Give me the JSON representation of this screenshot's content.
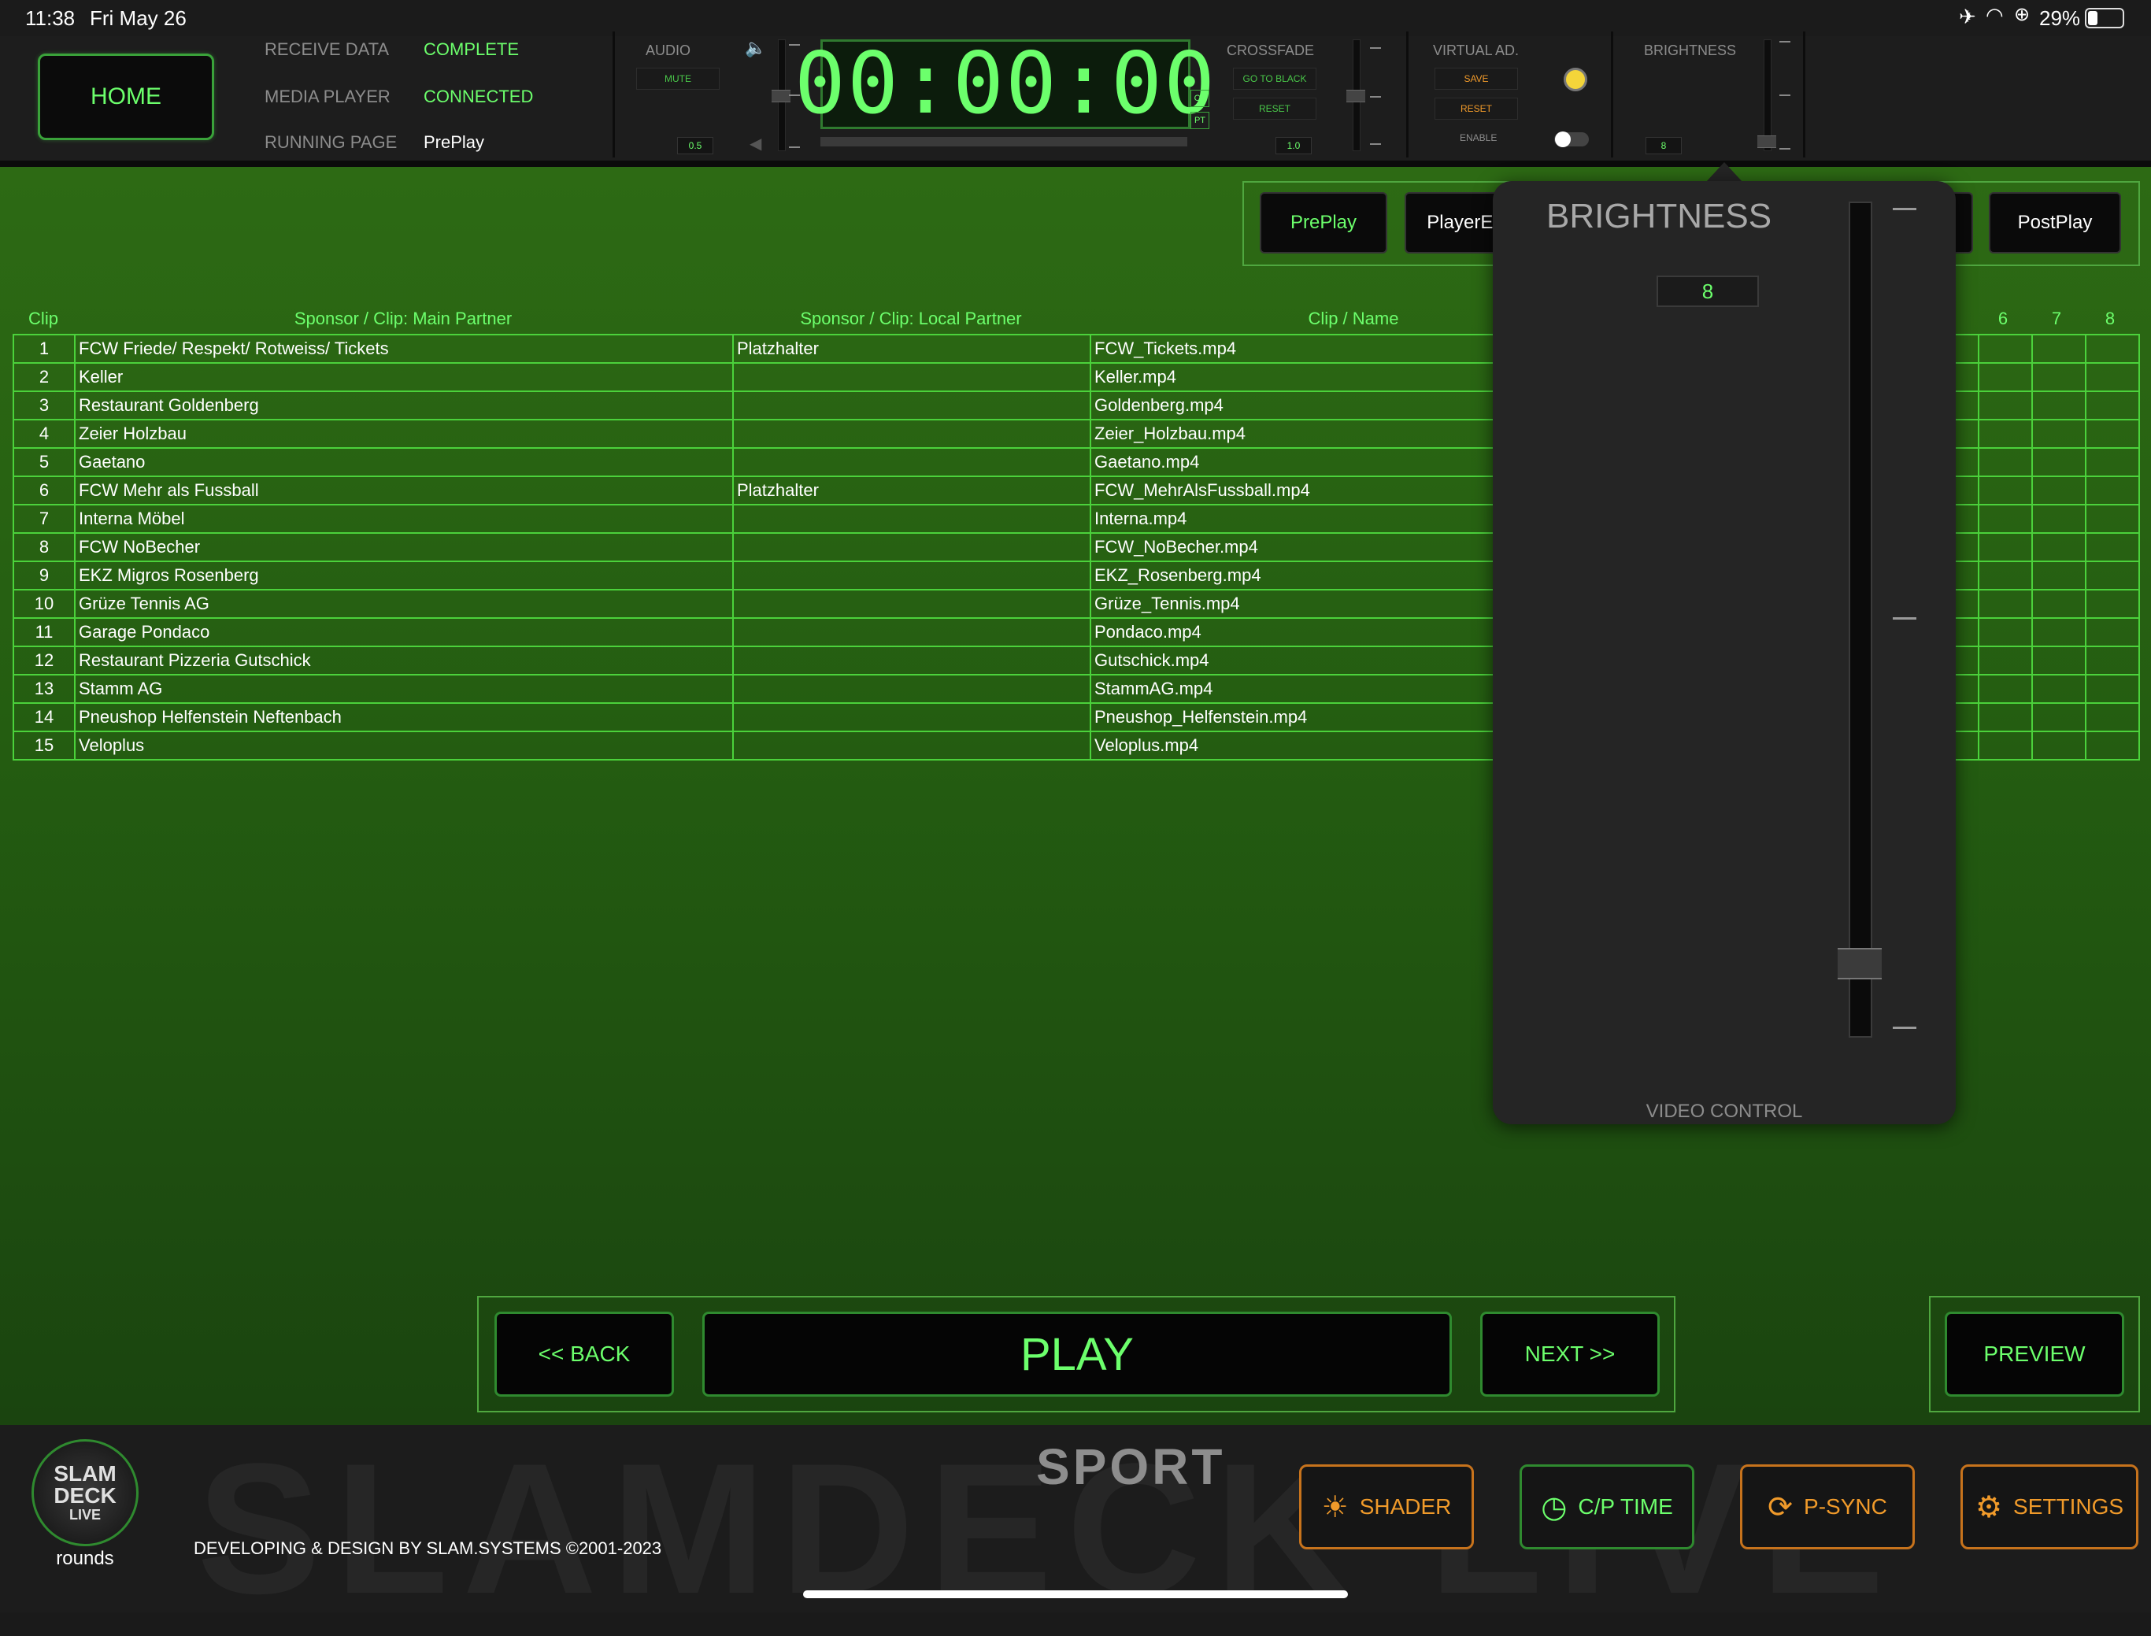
{
  "status_bar": {
    "time": "11:38",
    "date": "Fri May 26",
    "battery": "29%"
  },
  "header": {
    "home_label": "HOME",
    "info": [
      {
        "label": "RECEIVE DATA",
        "value": "COMPLETE"
      },
      {
        "label": "MEDIA PLAYER",
        "value": "CONNECTED"
      },
      {
        "label": "RUNNING PAGE",
        "value": "PrePlay"
      }
    ],
    "audio": {
      "label": "AUDIO",
      "mute_label": "MUTE",
      "value": "0.5"
    },
    "timer": {
      "display": "00:00:00",
      "tag_ct": "CT",
      "tag_pt": "PT"
    },
    "crossfade": {
      "label": "CROSSFADE",
      "go_to_black": "GO TO BLACK",
      "reset": "RESET",
      "value": "1.0"
    },
    "virtual_ad": {
      "label": "VIRTUAL AD.",
      "save": "SAVE",
      "reset": "RESET",
      "enable": "ENABLE"
    },
    "brightness": {
      "label": "BRIGHTNESS",
      "value": "8"
    }
  },
  "pages": {
    "tabs": [
      {
        "label": "PrePlay",
        "active": true
      },
      {
        "label": "PlayerEn"
      },
      {
        "label": "PostPlay"
      }
    ]
  },
  "table": {
    "headers": [
      "Clip",
      "Sponsor / Clip: Main Partner",
      "Sponsor / Clip: Local Partner",
      "Clip / Name",
      "6",
      "7",
      "8"
    ],
    "rows": [
      {
        "num": "1",
        "main": "FCW Friede/ Respekt/ Rotweiss/ Tickets",
        "local": "Platzhalter",
        "file": "FCW_Tickets.mp4"
      },
      {
        "num": "2",
        "main": "Keller",
        "local": "",
        "file": "Keller.mp4"
      },
      {
        "num": "3",
        "main": "Restaurant Goldenberg",
        "local": "",
        "file": "Goldenberg.mp4"
      },
      {
        "num": "4",
        "main": "Zeier Holzbau",
        "local": "",
        "file": "Zeier_Holzbau.mp4"
      },
      {
        "num": "5",
        "main": "Gaetano",
        "local": "",
        "file": "Gaetano.mp4"
      },
      {
        "num": "6",
        "main": "FCW Mehr als Fussball",
        "local": "Platzhalter",
        "file": "FCW_MehrAlsFussball.mp4"
      },
      {
        "num": "7",
        "main": "Interna Möbel",
        "local": "",
        "file": "Interna.mp4"
      },
      {
        "num": "8",
        "main": "FCW NoBecher",
        "local": "",
        "file": "FCW_NoBecher.mp4"
      },
      {
        "num": "9",
        "main": "EKZ Migros Rosenberg",
        "local": "",
        "file": "EKZ_Rosenberg.mp4"
      },
      {
        "num": "10",
        "main": "Grüze Tennis AG",
        "local": "",
        "file": "Grüze_Tennis.mp4"
      },
      {
        "num": "11",
        "main": "Garage Pondaco",
        "local": "",
        "file": "Pondaco.mp4"
      },
      {
        "num": "12",
        "main": "Restaurant Pizzeria Gutschick",
        "local": "",
        "file": "Gutschick.mp4"
      },
      {
        "num": "13",
        "main": "Stamm AG",
        "local": "",
        "file": "StammAG.mp4"
      },
      {
        "num": "14",
        "main": "Pneushop Helfenstein Neftenbach",
        "local": "",
        "file": "Pneushop_Helfenstein.mp4"
      },
      {
        "num": "15",
        "main": "Veloplus",
        "local": "",
        "file": "Veloplus.mp4"
      }
    ]
  },
  "popover": {
    "title": "BRIGHTNESS",
    "value": "8",
    "footer": "VIDEO CONTROL"
  },
  "transport": {
    "back": "<< BACK",
    "play": "PLAY",
    "next": "NEXT >>",
    "preview": "PREVIEW"
  },
  "footer": {
    "logo_lines": [
      "SLAM",
      "DECK",
      "LIVE"
    ],
    "logo_sub": "rounds",
    "watermark": "SLAMDECK LIVE",
    "sport": "SPORT",
    "credits": "DEVELOPING & DESIGN BY SLAM.SYSTEMS ©2001-2023",
    "buttons": {
      "shader": "SHADER",
      "cp_time": "C/P TIME",
      "p_sync": "P-SYNC",
      "settings": "SETTINGS"
    }
  },
  "colors": {
    "accent": "#6cff6c",
    "orange": "#f09a2a",
    "background_green": "#2d6a14"
  }
}
